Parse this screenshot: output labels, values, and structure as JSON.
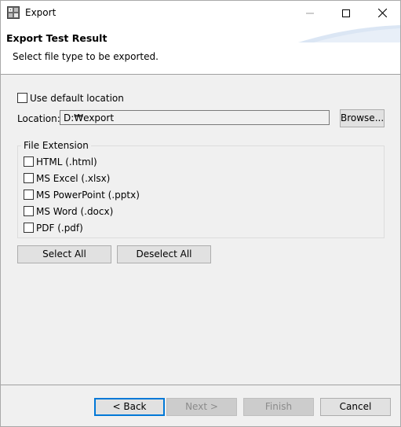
{
  "window": {
    "title": "Export",
    "icon": "app-icon"
  },
  "header": {
    "title": "Export Test Result",
    "description": "Select file type to be exported."
  },
  "location": {
    "use_default_label": "Use default location",
    "use_default_checked": false,
    "label": "Location:",
    "value": "D:₩export",
    "browse_label": "Browse..."
  },
  "file_extension": {
    "group_label": "File Extension",
    "options": [
      {
        "label": "HTML (.html)",
        "checked": false
      },
      {
        "label": "MS Excel (.xlsx)",
        "checked": false
      },
      {
        "label": "MS PowerPoint (.pptx)",
        "checked": false
      },
      {
        "label": "MS Word (.docx)",
        "checked": false
      },
      {
        "label": "PDF (.pdf)",
        "checked": false
      }
    ],
    "select_all_label": "Select All",
    "deselect_all_label": "Deselect All"
  },
  "footer": {
    "back_label": "< Back",
    "next_label": "Next >",
    "finish_label": "Finish",
    "cancel_label": "Cancel"
  },
  "colors": {
    "accent": "#0078d7",
    "header_swoosh": "#dbe6f4"
  }
}
